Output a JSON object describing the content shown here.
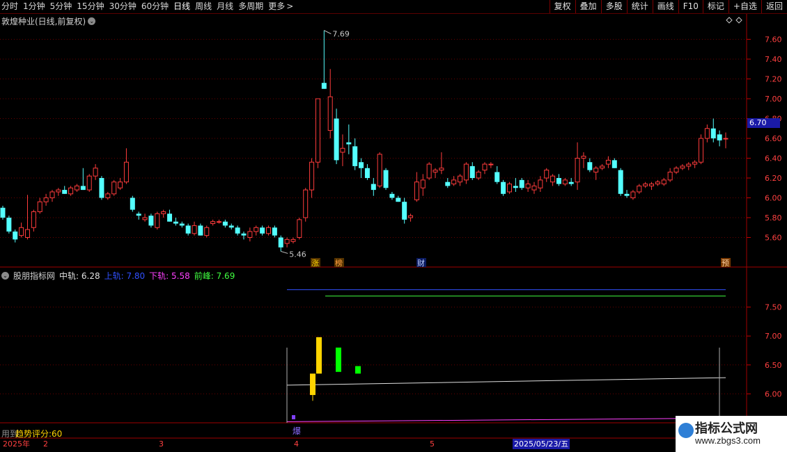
{
  "toolbar": {
    "periods": [
      "分时",
      "1分钟",
      "5分钟",
      "15分钟",
      "30分钟",
      "60分钟",
      "日线",
      "周线",
      "月线",
      "多周期",
      "更多"
    ],
    "active_period": "日线",
    "more_chevron": ">",
    "actions": [
      "复权",
      "叠加",
      "多股",
      "统计",
      "画线",
      "F10",
      "标记",
      "+自选",
      "返回"
    ]
  },
  "stock": {
    "title": "敦煌种业(日线,前复权)",
    "current_price": "6.70",
    "high_label": "7.69",
    "low_label": "5.46"
  },
  "events": [
    "涨",
    "榜",
    "财",
    "预"
  ],
  "indicator": {
    "name": "股朋指标网",
    "mid_label": "中轨: 6.28",
    "upper_label": "上轨: 7.80",
    "lower_label": "下轨: 5.58",
    "peak_label": "前峰: 7.69",
    "colors": {
      "mid": "#e0e0e0",
      "upper": "#3050ff",
      "lower": "#ff40ff",
      "peak": "#40ff40"
    },
    "marker": "爆"
  },
  "score": "趋势评分:60",
  "hint": "用到",
  "dates": {
    "year": "2025年",
    "months": [
      "2",
      "3",
      "4",
      "5"
    ],
    "selected": "2025/05/23/五"
  },
  "watermark": {
    "title": "指标公式网",
    "url": "www.zbgs3.com"
  },
  "chart_data": [
    {
      "type": "candlestick",
      "title": "敦煌种业(日线,前复权)",
      "ylim": [
        5.4,
        7.8
      ],
      "yticks": [
        "5.60",
        "5.80",
        "6.00",
        "6.20",
        "6.40",
        "6.60",
        "6.80",
        "7.00",
        "7.20",
        "7.40",
        "7.60"
      ],
      "up_color": "#ff3c3c",
      "down_color": "#54ffff",
      "candles": [
        [
          5.9,
          5.92,
          5.78,
          5.8
        ],
        [
          5.8,
          5.82,
          5.64,
          5.66
        ],
        [
          5.66,
          5.68,
          5.55,
          5.58
        ],
        [
          5.62,
          5.75,
          5.6,
          5.7
        ],
        [
          5.6,
          6.03,
          5.58,
          5.68
        ],
        [
          5.7,
          5.88,
          5.66,
          5.86
        ],
        [
          5.86,
          6.0,
          5.84,
          5.96
        ],
        [
          5.96,
          6.04,
          5.92,
          6.0
        ],
        [
          6.0,
          6.08,
          5.96,
          6.06
        ],
        [
          6.06,
          6.1,
          6.02,
          6.08
        ],
        [
          6.08,
          6.12,
          6.04,
          6.04
        ],
        [
          6.04,
          6.12,
          6.02,
          6.1
        ],
        [
          6.08,
          6.14,
          6.06,
          6.12
        ],
        [
          6.12,
          6.3,
          6.08,
          6.08
        ],
        [
          6.08,
          6.24,
          6.06,
          6.22
        ],
        [
          6.22,
          6.34,
          6.18,
          6.3
        ],
        [
          6.2,
          6.22,
          5.98,
          6.0
        ],
        [
          6.0,
          6.06,
          5.98,
          6.04
        ],
        [
          6.04,
          6.18,
          6.02,
          6.16
        ],
        [
          6.1,
          6.2,
          6.08,
          6.16
        ],
        [
          6.16,
          6.5,
          6.14,
          6.36
        ],
        [
          6.0,
          6.02,
          5.86,
          5.88
        ],
        [
          5.84,
          5.86,
          5.78,
          5.82
        ],
        [
          5.78,
          5.84,
          5.76,
          5.8
        ],
        [
          5.82,
          5.84,
          5.7,
          5.72
        ],
        [
          5.7,
          5.86,
          5.68,
          5.84
        ],
        [
          5.84,
          5.88,
          5.8,
          5.86
        ],
        [
          5.84,
          5.88,
          5.76,
          5.76
        ],
        [
          5.76,
          5.8,
          5.72,
          5.74
        ],
        [
          5.74,
          5.76,
          5.7,
          5.72
        ],
        [
          5.72,
          5.74,
          5.62,
          5.64
        ],
        [
          5.64,
          5.76,
          5.62,
          5.72
        ],
        [
          5.72,
          5.74,
          5.62,
          5.62
        ],
        [
          5.62,
          5.72,
          5.6,
          5.7
        ],
        [
          5.74,
          5.78,
          5.72,
          5.76
        ],
        [
          5.76,
          5.78,
          5.74,
          5.76
        ],
        [
          5.76,
          5.78,
          5.7,
          5.72
        ],
        [
          5.72,
          5.74,
          5.68,
          5.7
        ],
        [
          5.7,
          5.72,
          5.62,
          5.64
        ],
        [
          5.64,
          5.66,
          5.58,
          5.62
        ],
        [
          5.6,
          5.7,
          5.56,
          5.66
        ],
        [
          5.66,
          5.72,
          5.62,
          5.7
        ],
        [
          5.7,
          5.72,
          5.62,
          5.64
        ],
        [
          5.64,
          5.72,
          5.62,
          5.7
        ],
        [
          5.7,
          5.72,
          5.6,
          5.62
        ],
        [
          5.6,
          5.62,
          5.46,
          5.5
        ],
        [
          5.54,
          5.6,
          5.5,
          5.58
        ],
        [
          5.56,
          5.6,
          5.54,
          5.58
        ],
        [
          5.6,
          5.8,
          5.58,
          5.78
        ],
        [
          5.8,
          6.1,
          5.76,
          6.08
        ],
        [
          6.08,
          6.4,
          6.0,
          6.36
        ],
        [
          6.36,
          7.0,
          6.3,
          7.0
        ],
        [
          7.16,
          7.69,
          7.1,
          7.1
        ],
        [
          6.68,
          7.3,
          6.6,
          7.02
        ],
        [
          6.8,
          6.9,
          6.34,
          6.38
        ],
        [
          6.46,
          6.64,
          6.32,
          6.5
        ],
        [
          6.56,
          6.74,
          6.44,
          6.54
        ],
        [
          6.52,
          6.6,
          6.28,
          6.32
        ],
        [
          6.36,
          6.4,
          6.2,
          6.3
        ],
        [
          6.3,
          6.34,
          6.18,
          6.2
        ],
        [
          6.14,
          6.2,
          6.02,
          6.08
        ],
        [
          6.12,
          6.46,
          6.1,
          6.44
        ],
        [
          6.28,
          6.3,
          6.08,
          6.1
        ],
        [
          6.04,
          6.06,
          5.98,
          6.0
        ],
        [
          6.0,
          6.02,
          5.96,
          5.96
        ],
        [
          5.96,
          6.0,
          5.74,
          5.78
        ],
        [
          5.8,
          5.84,
          5.76,
          5.82
        ],
        [
          5.98,
          6.26,
          5.96,
          6.16
        ],
        [
          6.1,
          6.24,
          6.02,
          6.18
        ],
        [
          6.2,
          6.36,
          6.18,
          6.34
        ],
        [
          6.26,
          6.3,
          6.2,
          6.28
        ],
        [
          6.28,
          6.46,
          6.24,
          6.3
        ],
        [
          6.16,
          6.2,
          6.1,
          6.12
        ],
        [
          6.14,
          6.22,
          6.12,
          6.18
        ],
        [
          6.16,
          6.24,
          6.12,
          6.22
        ],
        [
          6.18,
          6.36,
          6.14,
          6.34
        ],
        [
          6.32,
          6.36,
          6.18,
          6.2
        ],
        [
          6.2,
          6.28,
          6.18,
          6.26
        ],
        [
          6.28,
          6.36,
          6.24,
          6.34
        ],
        [
          6.34,
          6.36,
          6.3,
          6.34
        ],
        [
          6.26,
          6.32,
          6.14,
          6.16
        ],
        [
          6.16,
          6.18,
          6.02,
          6.04
        ],
        [
          6.06,
          6.16,
          6.04,
          6.14
        ],
        [
          6.12,
          6.2,
          6.06,
          6.1
        ],
        [
          6.18,
          6.2,
          6.08,
          6.1
        ],
        [
          6.1,
          6.18,
          6.06,
          6.14
        ],
        [
          6.08,
          6.16,
          6.04,
          6.12
        ],
        [
          6.1,
          6.22,
          6.06,
          6.18
        ],
        [
          6.2,
          6.3,
          6.16,
          6.28
        ],
        [
          6.16,
          6.24,
          6.12,
          6.22
        ],
        [
          6.2,
          6.24,
          6.12,
          6.14
        ],
        [
          6.14,
          6.2,
          6.12,
          6.18
        ],
        [
          6.16,
          6.2,
          6.12,
          6.14
        ],
        [
          6.16,
          6.56,
          6.08,
          6.4
        ],
        [
          6.4,
          6.46,
          6.3,
          6.42
        ],
        [
          6.36,
          6.4,
          6.26,
          6.28
        ],
        [
          6.26,
          6.32,
          6.18,
          6.3
        ],
        [
          6.3,
          6.34,
          6.28,
          6.32
        ],
        [
          6.34,
          6.42,
          6.3,
          6.38
        ],
        [
          6.38,
          6.4,
          6.3,
          6.3
        ],
        [
          6.28,
          6.3,
          6.02,
          6.04
        ],
        [
          6.04,
          6.08,
          6.0,
          6.02
        ],
        [
          6.0,
          6.08,
          5.98,
          6.06
        ],
        [
          6.06,
          6.14,
          6.04,
          6.12
        ],
        [
          6.12,
          6.16,
          6.1,
          6.14
        ],
        [
          6.12,
          6.16,
          6.08,
          6.14
        ],
        [
          6.14,
          6.18,
          6.12,
          6.16
        ],
        [
          6.14,
          6.2,
          6.12,
          6.18
        ],
        [
          6.18,
          6.3,
          6.16,
          6.26
        ],
        [
          6.26,
          6.32,
          6.24,
          6.3
        ],
        [
          6.3,
          6.34,
          6.28,
          6.32
        ],
        [
          6.32,
          6.36,
          6.28,
          6.34
        ],
        [
          6.34,
          6.38,
          6.3,
          6.36
        ],
        [
          6.36,
          6.64,
          6.34,
          6.6
        ],
        [
          6.6,
          6.74,
          6.56,
          6.7
        ],
        [
          6.7,
          6.8,
          6.56,
          6.6
        ],
        [
          6.64,
          6.68,
          6.52,
          6.58
        ],
        [
          6.6,
          6.66,
          6.5,
          6.6
        ]
      ]
    },
    {
      "type": "line",
      "title": "股朋指标网",
      "ylim": [
        5.5,
        8.0
      ],
      "yticks": [
        "6.00",
        "6.50",
        "7.00",
        "7.50"
      ],
      "series": [
        {
          "name": "上轨",
          "values": [
            7.8,
            7.8
          ]
        },
        {
          "name": "前峰",
          "values": [
            7.69,
            7.69
          ]
        },
        {
          "name": "中轨",
          "values": [
            6.15,
            6.28
          ]
        },
        {
          "name": "下轨",
          "values": [
            5.52,
            5.58
          ]
        }
      ],
      "bars": [
        {
          "open": 5.98,
          "close": 6.35,
          "low": 5.88,
          "high": 6.35,
          "color": "#ffd400"
        },
        {
          "open": 6.35,
          "close": 6.98,
          "low": 6.35,
          "high": 6.98,
          "color": "#ffd400"
        },
        {
          "open": 6.38,
          "close": 6.8,
          "low": 6.38,
          "high": 6.8,
          "color": "#00ff00"
        },
        {
          "open": 6.35,
          "close": 6.48,
          "low": 6.35,
          "high": 6.48,
          "color": "#00ff00"
        }
      ]
    }
  ]
}
